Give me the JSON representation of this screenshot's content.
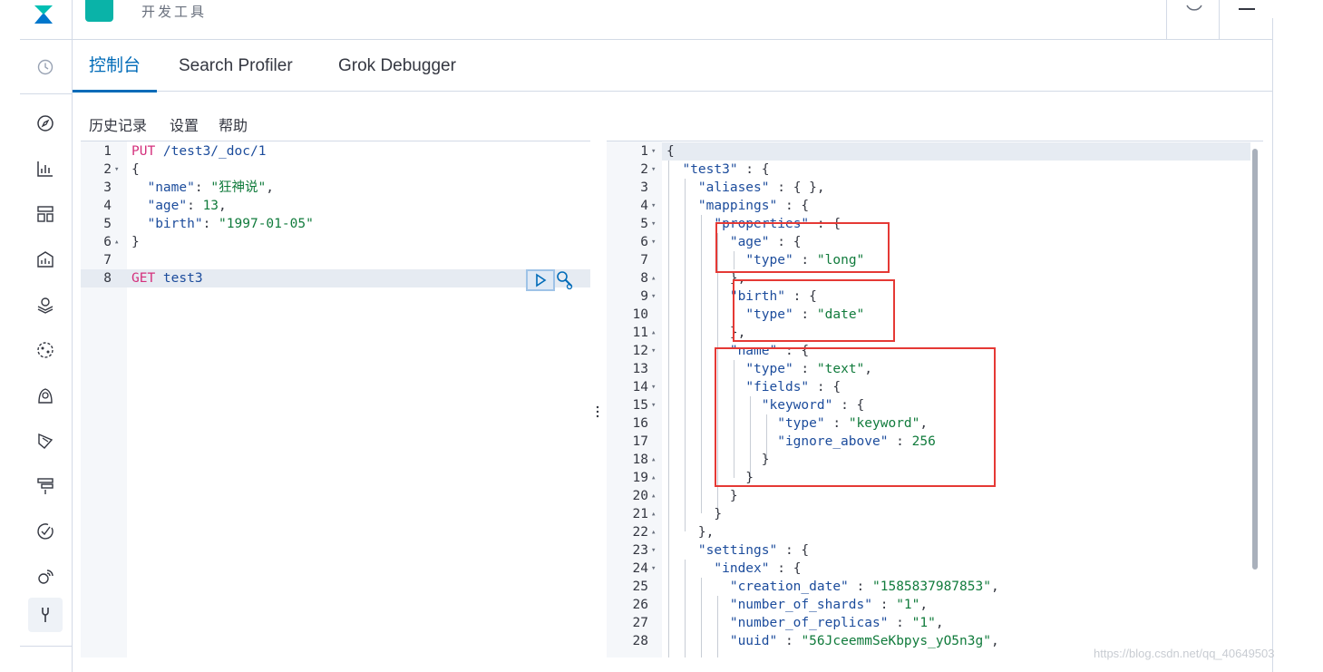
{
  "header": {
    "title": "开发工具"
  },
  "tabs": [
    {
      "label": "控制台",
      "active": true
    },
    {
      "label": "Search Profiler",
      "active": false
    },
    {
      "label": "Grok Debugger",
      "active": false
    }
  ],
  "toolbar": {
    "history": "历史记录",
    "settings": "设置",
    "help": "帮助"
  },
  "request_lines": [
    {
      "n": "1",
      "fold": ""
    },
    {
      "n": "2",
      "fold": "▾"
    },
    {
      "n": "3",
      "fold": ""
    },
    {
      "n": "4",
      "fold": ""
    },
    {
      "n": "5",
      "fold": ""
    },
    {
      "n": "6",
      "fold": "▴"
    },
    {
      "n": "7",
      "fold": ""
    },
    {
      "n": "8",
      "fold": ""
    }
  ],
  "request": {
    "l1_method": "PUT",
    "l1_path": " /test3/_doc/1",
    "l2": "{",
    "l3_key": "  \"name\"",
    "l3_sep": ": ",
    "l3_val": "\"狂神说\"",
    "l3_end": ",",
    "l4_key": "  \"age\"",
    "l4_sep": ": ",
    "l4_val": "13",
    "l4_end": ",",
    "l5_key": "  \"birth\"",
    "l5_sep": ": ",
    "l5_val": "\"1997-01-05\"",
    "l6": "}",
    "l8_method": "GET",
    "l8_path": " test3"
  },
  "response_lines": [
    {
      "n": "1",
      "fold": "▾"
    },
    {
      "n": "2",
      "fold": "▾"
    },
    {
      "n": "3",
      "fold": ""
    },
    {
      "n": "4",
      "fold": "▾"
    },
    {
      "n": "5",
      "fold": "▾"
    },
    {
      "n": "6",
      "fold": "▾"
    },
    {
      "n": "7",
      "fold": ""
    },
    {
      "n": "8",
      "fold": "▴"
    },
    {
      "n": "9",
      "fold": "▾"
    },
    {
      "n": "10",
      "fold": ""
    },
    {
      "n": "11",
      "fold": "▴"
    },
    {
      "n": "12",
      "fold": "▾"
    },
    {
      "n": "13",
      "fold": ""
    },
    {
      "n": "14",
      "fold": "▾"
    },
    {
      "n": "15",
      "fold": "▾"
    },
    {
      "n": "16",
      "fold": ""
    },
    {
      "n": "17",
      "fold": ""
    },
    {
      "n": "18",
      "fold": "▴"
    },
    {
      "n": "19",
      "fold": "▴"
    },
    {
      "n": "20",
      "fold": "▴"
    },
    {
      "n": "21",
      "fold": "▴"
    },
    {
      "n": "22",
      "fold": "▴"
    },
    {
      "n": "23",
      "fold": "▾"
    },
    {
      "n": "24",
      "fold": "▾"
    },
    {
      "n": "25",
      "fold": ""
    },
    {
      "n": "26",
      "fold": ""
    },
    {
      "n": "27",
      "fold": ""
    },
    {
      "n": "28",
      "fold": ""
    }
  ],
  "response": [
    [
      [
        "p",
        "{"
      ]
    ],
    [
      [
        "p",
        "  "
      ],
      [
        "k",
        "\"test3\""
      ],
      [
        "p",
        " : {"
      ]
    ],
    [
      [
        "p",
        "    "
      ],
      [
        "k",
        "\"aliases\""
      ],
      [
        "p",
        " : { },"
      ]
    ],
    [
      [
        "p",
        "    "
      ],
      [
        "k",
        "\"mappings\""
      ],
      [
        "p",
        " : {"
      ]
    ],
    [
      [
        "p",
        "      "
      ],
      [
        "k",
        "\"properties\""
      ],
      [
        "p",
        " : {"
      ]
    ],
    [
      [
        "p",
        "        "
      ],
      [
        "k",
        "\"age\""
      ],
      [
        "p",
        " : {"
      ]
    ],
    [
      [
        "p",
        "          "
      ],
      [
        "k",
        "\"type\""
      ],
      [
        "p",
        " : "
      ],
      [
        "s",
        "\"long\""
      ]
    ],
    [
      [
        "p",
        "        },"
      ]
    ],
    [
      [
        "p",
        "        "
      ],
      [
        "k",
        "\"birth\""
      ],
      [
        "p",
        " : {"
      ]
    ],
    [
      [
        "p",
        "          "
      ],
      [
        "k",
        "\"type\""
      ],
      [
        "p",
        " : "
      ],
      [
        "s",
        "\"date\""
      ]
    ],
    [
      [
        "p",
        "        },"
      ]
    ],
    [
      [
        "p",
        "        "
      ],
      [
        "k",
        "\"name\""
      ],
      [
        "p",
        " : {"
      ]
    ],
    [
      [
        "p",
        "          "
      ],
      [
        "k",
        "\"type\""
      ],
      [
        "p",
        " : "
      ],
      [
        "s",
        "\"text\""
      ],
      [
        "p",
        ","
      ]
    ],
    [
      [
        "p",
        "          "
      ],
      [
        "k",
        "\"fields\""
      ],
      [
        "p",
        " : {"
      ]
    ],
    [
      [
        "p",
        "            "
      ],
      [
        "k",
        "\"keyword\""
      ],
      [
        "p",
        " : {"
      ]
    ],
    [
      [
        "p",
        "              "
      ],
      [
        "k",
        "\"type\""
      ],
      [
        "p",
        " : "
      ],
      [
        "s",
        "\"keyword\""
      ],
      [
        "p",
        ","
      ]
    ],
    [
      [
        "p",
        "              "
      ],
      [
        "k",
        "\"ignore_above\""
      ],
      [
        "p",
        " : "
      ],
      [
        "n",
        "256"
      ]
    ],
    [
      [
        "p",
        "            }"
      ]
    ],
    [
      [
        "p",
        "          }"
      ]
    ],
    [
      [
        "p",
        "        }"
      ]
    ],
    [
      [
        "p",
        "      }"
      ]
    ],
    [
      [
        "p",
        "    },"
      ]
    ],
    [
      [
        "p",
        "    "
      ],
      [
        "k",
        "\"settings\""
      ],
      [
        "p",
        " : {"
      ]
    ],
    [
      [
        "p",
        "      "
      ],
      [
        "k",
        "\"index\""
      ],
      [
        "p",
        " : {"
      ]
    ],
    [
      [
        "p",
        "        "
      ],
      [
        "k",
        "\"creation_date\""
      ],
      [
        "p",
        " : "
      ],
      [
        "s",
        "\"1585837987853\""
      ],
      [
        "p",
        ","
      ]
    ],
    [
      [
        "p",
        "        "
      ],
      [
        "k",
        "\"number_of_shards\""
      ],
      [
        "p",
        " : "
      ],
      [
        "s",
        "\"1\""
      ],
      [
        "p",
        ","
      ]
    ],
    [
      [
        "p",
        "        "
      ],
      [
        "k",
        "\"number_of_replicas\""
      ],
      [
        "p",
        " : "
      ],
      [
        "s",
        "\"1\""
      ],
      [
        "p",
        ","
      ]
    ],
    [
      [
        "p",
        "        "
      ],
      [
        "k",
        "\"uuid\""
      ],
      [
        "p",
        " : "
      ],
      [
        "s",
        "\"56JceemmSeKbpys_yO5n3g\""
      ],
      [
        "p",
        ","
      ]
    ]
  ],
  "watermark": "https://blog.csdn.net/qq_40649503",
  "colors": {
    "accent": "#006bb8",
    "highlight_box": "#e53935",
    "brand": "#0ab3a8"
  }
}
